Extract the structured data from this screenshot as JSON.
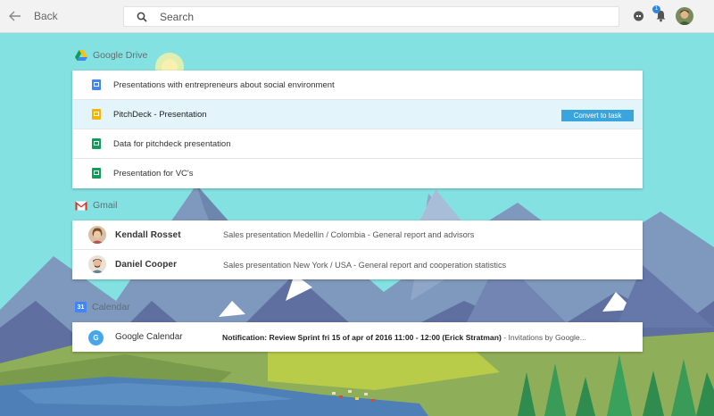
{
  "topbar": {
    "back_label": "Back",
    "search_placeholder": "Search",
    "notification_count": "1"
  },
  "drive": {
    "title": "Google Drive",
    "convert_label": "Convert to task",
    "files": [
      {
        "name": "Presentations with entrepreneurs about social environment",
        "icon": "doc-icon",
        "color": "#4285f4"
      },
      {
        "name": "PitchDeck - Presentation",
        "icon": "slides-icon",
        "color": "#f4b400"
      },
      {
        "name": "Data for pitchdeck presentation",
        "icon": "sheets-icon",
        "color": "#0f9d58"
      },
      {
        "name": "Presentation for VC's",
        "icon": "sheets-icon",
        "color": "#0f9d58"
      }
    ]
  },
  "gmail": {
    "title": "Gmail",
    "emails": [
      {
        "sender": "Kendall Rosset",
        "subject": "Sales presentation Medellin / Colombia - General report and advisors"
      },
      {
        "sender": "Daniel Cooper",
        "subject": "Sales presentation New York / USA - General report and cooperation statistics"
      }
    ]
  },
  "calendar": {
    "title": "Calendar",
    "icon_number": "31",
    "event": {
      "source": "Google Calendar",
      "badge": "G",
      "notification": "Notification: Review Sprint fri 15 of apr of 2016 11:00 - 12:00 (Erick Stratman)",
      "rest": " - Invitations by Google..."
    }
  },
  "colors": {
    "sky": "#84e1e2",
    "accent": "#3aa4dc",
    "selected_row": "#e3f4fb"
  }
}
